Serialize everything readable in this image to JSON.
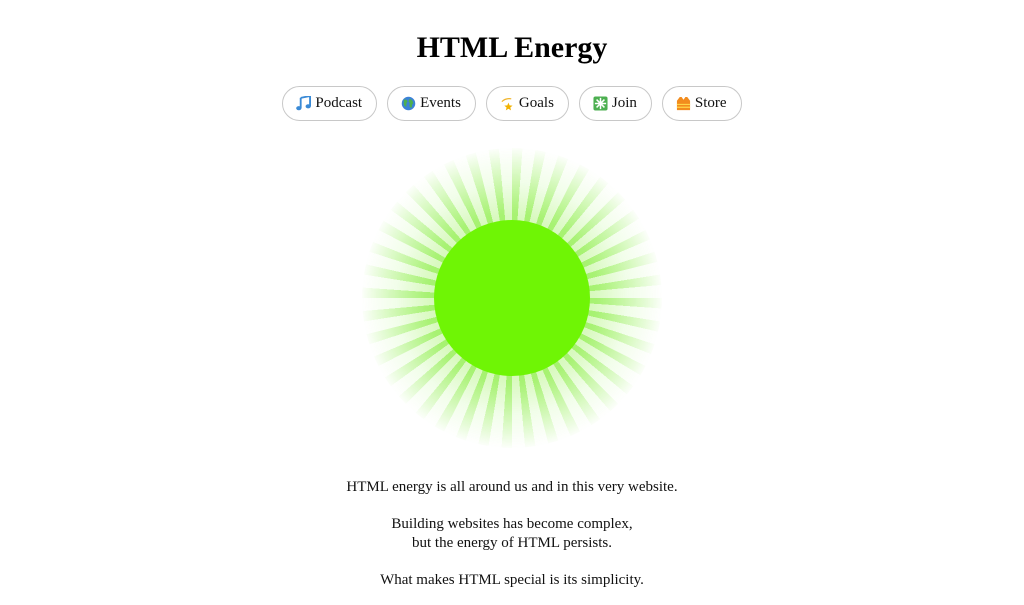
{
  "title": "HTML Energy",
  "nav": [
    {
      "label": "Podcast",
      "icon": "music-note-icon"
    },
    {
      "label": "Events",
      "icon": "globe-icon"
    },
    {
      "label": "Goals",
      "icon": "star-icon"
    },
    {
      "label": "Join",
      "icon": "sparkle-box-icon"
    },
    {
      "label": "Store",
      "icon": "vest-icon"
    }
  ],
  "colors": {
    "sun": "#6ff505",
    "button_border": "#c8c8c8"
  },
  "body": {
    "line1": "HTML energy is all around us and in this very website.",
    "line2": "Building websites has become complex,",
    "line3": "but the energy of HTML persists.",
    "line4": "What makes HTML special is its simplicity."
  }
}
